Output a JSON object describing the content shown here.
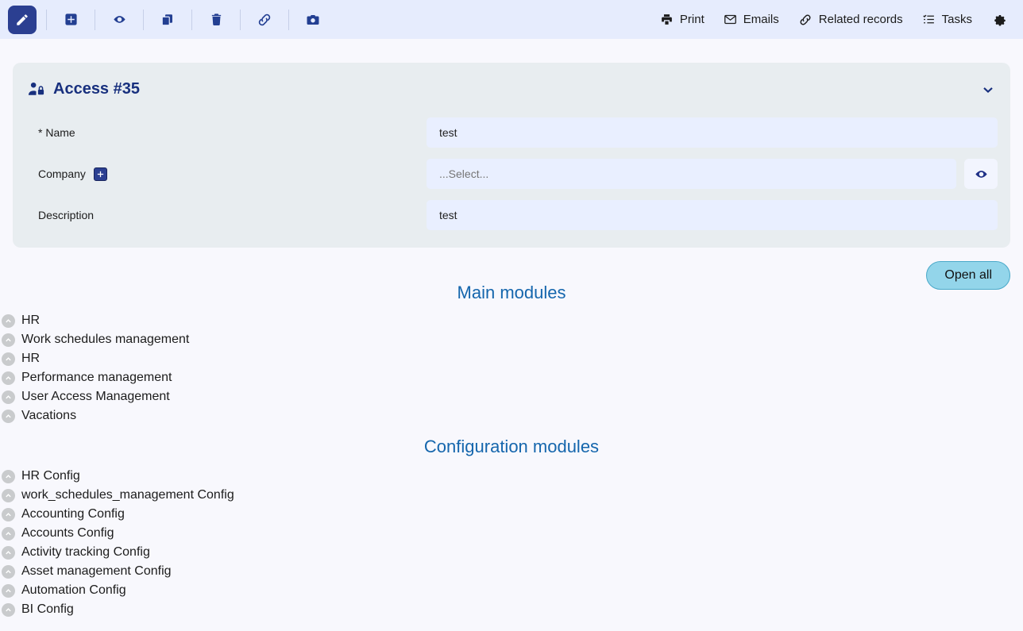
{
  "toolbar": {
    "left_buttons": [
      {
        "name": "edit-button",
        "icon": "pencil-icon",
        "active": true
      },
      {
        "name": "add-button",
        "icon": "plus-square-icon",
        "active": false
      },
      {
        "name": "view-button",
        "icon": "eye-icon",
        "active": false
      },
      {
        "name": "duplicate-button",
        "icon": "copy-icon",
        "active": false
      },
      {
        "name": "delete-button",
        "icon": "trash-icon",
        "active": false
      },
      {
        "name": "link-button",
        "icon": "link-icon",
        "active": false
      },
      {
        "name": "screenshot-button",
        "icon": "camera-icon",
        "active": false
      }
    ],
    "right_items": [
      {
        "label": "Print",
        "icon": "printer-icon"
      },
      {
        "label": "Emails",
        "icon": "envelope-icon"
      },
      {
        "label": "Related records",
        "icon": "link-icon"
      },
      {
        "label": "Tasks",
        "icon": "list-check-icon"
      }
    ],
    "settings_icon": "gear-icon"
  },
  "card": {
    "title": "Access #35",
    "title_icon": "user-lock-icon",
    "collapse_icon": "chevron-down-icon",
    "fields": [
      {
        "label": "* Name",
        "value": "test",
        "placeholder": "",
        "has_plus": false,
        "has_eye": false
      },
      {
        "label": "Company",
        "value": "",
        "placeholder": "...Select...",
        "has_plus": true,
        "has_eye": true
      },
      {
        "label": "Description",
        "value": "test",
        "placeholder": "",
        "has_plus": false,
        "has_eye": false
      }
    ]
  },
  "open_all_button": "Open all",
  "sections": [
    {
      "title": "Main modules",
      "items": [
        "HR",
        "Work schedules management",
        "HR",
        "Performance management",
        "User Access Management",
        "Vacations"
      ]
    },
    {
      "title": "Configuration modules",
      "items": [
        "HR Config",
        "work_schedules_management Config",
        "Accounting Config",
        "Accounts Config",
        "Activity tracking Config",
        "Asset management Config",
        "Automation Config",
        "BI Config"
      ]
    }
  ],
  "colors": {
    "toolbar_bg": "#e6ecfd",
    "page_bg": "#f8f8fd",
    "card_bg": "#e8edf0",
    "input_bg": "#e9efff",
    "accent_dark_blue": "#2b3f91",
    "title_blue": "#18307e",
    "section_blue": "#1566ad",
    "open_all_bg": "#93d5ea",
    "module_icon_gray": "#c9cbcd"
  }
}
